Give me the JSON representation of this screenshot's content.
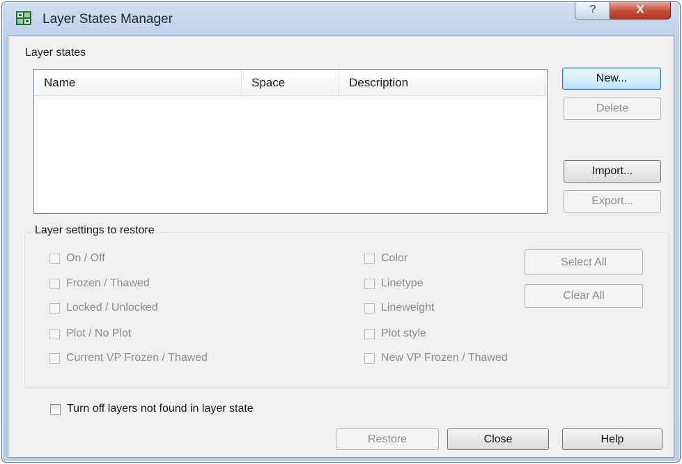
{
  "window": {
    "title": "Layer States Manager",
    "help_glyph": "?",
    "close_glyph": "X"
  },
  "layer_states": {
    "group_label": "Layer states",
    "columns": [
      "Name",
      "Space",
      "Description"
    ],
    "rows": []
  },
  "side_buttons": {
    "new": "New...",
    "delete": "Delete",
    "import": "Import...",
    "export": "Export..."
  },
  "settings": {
    "group_label": "Layer settings to restore",
    "left_options": [
      "On / Off",
      "Frozen / Thawed",
      "Locked / Unlocked",
      "Plot / No Plot",
      "Current VP Frozen / Thawed"
    ],
    "right_options": [
      "Color",
      "Linetype",
      "Lineweight",
      "Plot style",
      "New VP Frozen / Thawed"
    ],
    "select_all": "Select All",
    "clear_all": "Clear All"
  },
  "turn_off_option": "Turn off layers not found in layer state",
  "footer": {
    "restore": "Restore",
    "close": "Close",
    "help": "Help"
  },
  "colors": {
    "title_bar": "#bcd2ea",
    "close_button": "#c8513d",
    "default_button": "#bee6fd",
    "disabled_text": "#8c8c8c"
  }
}
